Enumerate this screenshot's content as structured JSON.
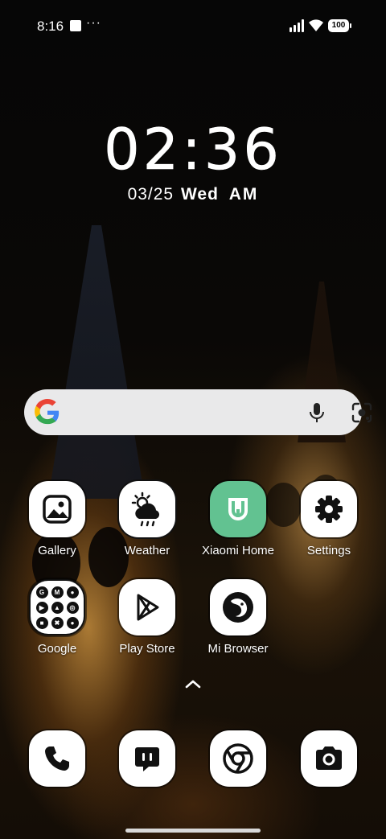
{
  "status_bar": {
    "time": "8:16",
    "more": "···",
    "battery": "100",
    "icons": [
      "notification-square-icon",
      "signal-icon",
      "wifi-icon",
      "battery-icon"
    ]
  },
  "clock": {
    "time": "02:36",
    "date": "03/25",
    "weekday": "Wed",
    "ampm": "AM"
  },
  "search": {
    "icons": [
      "google-g-icon",
      "microphone-icon",
      "google-lens-icon"
    ]
  },
  "apps": [
    {
      "label": "Gallery",
      "icon": "gallery-icon"
    },
    {
      "label": "Weather",
      "icon": "weather-icon"
    },
    {
      "label": "Xiaomi Home",
      "icon": "xiaomi-home-icon"
    },
    {
      "label": "Settings",
      "icon": "gear-icon"
    },
    {
      "label": "Google",
      "icon": "folder-icon"
    },
    {
      "label": "Play Store",
      "icon": "play-store-icon"
    },
    {
      "label": "Mi Browser",
      "icon": "mi-browser-icon"
    }
  ],
  "google_folder": {
    "items": [
      "G",
      "M",
      "●",
      "▶",
      "▲",
      "◎",
      "■",
      "✖",
      "●"
    ]
  },
  "dock": [
    {
      "icon": "phone-icon"
    },
    {
      "icon": "messages-icon"
    },
    {
      "icon": "chrome-icon"
    },
    {
      "icon": "camera-icon"
    }
  ],
  "colors": {
    "mi_home": "#62c291",
    "search_bg": "#e9e9ea",
    "icon_bg": "#ffffff"
  }
}
